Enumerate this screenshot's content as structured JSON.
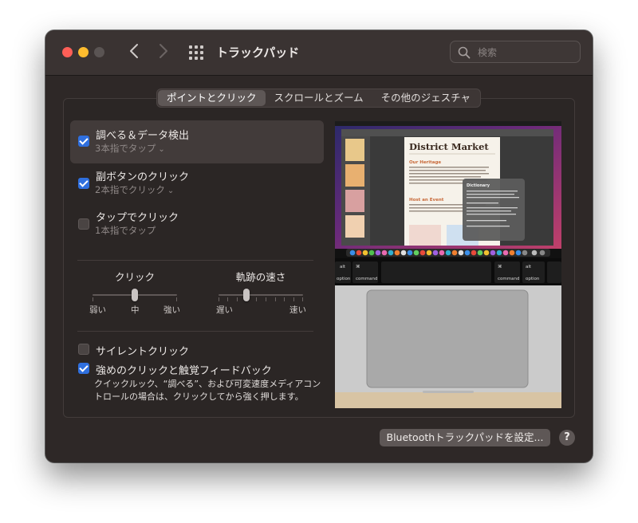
{
  "window": {
    "title": "トラックパッド"
  },
  "search": {
    "placeholder": "検索"
  },
  "tabs": [
    {
      "label": "ポイントとクリック"
    },
    {
      "label": "スクロールとズーム"
    },
    {
      "label": "その他のジェスチャ"
    }
  ],
  "features": [
    {
      "title": "調べる＆データ検出",
      "subtitle": "3本指でタップ",
      "checked": true,
      "has_menu": true
    },
    {
      "title": "副ボタンのクリック",
      "subtitle": "2本指でクリック",
      "checked": true,
      "has_menu": true
    },
    {
      "title": "タップでクリック",
      "subtitle": "1本指でタップ",
      "checked": false,
      "has_menu": false
    }
  ],
  "sliders": {
    "click": {
      "label": "クリック",
      "min_label": "弱い",
      "mid_label": "中",
      "max_label": "強い",
      "value": 0.5
    },
    "tracking": {
      "label": "軌跡の速さ",
      "min_label": "遅い",
      "max_label": "速い",
      "value": 0.33
    }
  },
  "options": {
    "silent_click": {
      "label": "サイレントクリック",
      "checked": false
    },
    "force_click": {
      "label": "強めのクリックと触覚フィードバック",
      "checked": true
    },
    "description": "クイックルック、“調べる”、および可変速度メディアコントロールの場合は、クリックしてから強く押します。"
  },
  "preview": {
    "doc_title": "District Market",
    "heading_1": "Our Heritage",
    "heading_2": "Host an Event",
    "popup_title": "Dictionary",
    "keys": {
      "alt": "alt",
      "option": "option",
      "cmd_symbol": "⌘",
      "command": "command"
    }
  },
  "buttons": {
    "bluetooth": "Bluetoothトラックパッドを設定...",
    "help": "?"
  },
  "colors": {
    "accent": "#2f6fde",
    "window_bg": "#2e2827"
  }
}
